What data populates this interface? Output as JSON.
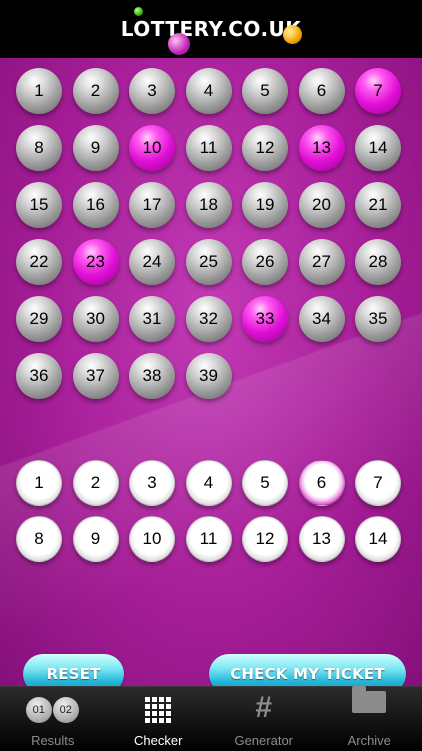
{
  "header": {
    "logo_text": "LOTTERY.CO.UK"
  },
  "main_balls": [
    {
      "n": "1",
      "sel": false
    },
    {
      "n": "2",
      "sel": false
    },
    {
      "n": "3",
      "sel": false
    },
    {
      "n": "4",
      "sel": false
    },
    {
      "n": "5",
      "sel": false
    },
    {
      "n": "6",
      "sel": false
    },
    {
      "n": "7",
      "sel": true
    },
    {
      "n": "8",
      "sel": false
    },
    {
      "n": "9",
      "sel": false
    },
    {
      "n": "10",
      "sel": true
    },
    {
      "n": "11",
      "sel": false
    },
    {
      "n": "12",
      "sel": false
    },
    {
      "n": "13",
      "sel": true
    },
    {
      "n": "14",
      "sel": false
    },
    {
      "n": "15",
      "sel": false
    },
    {
      "n": "16",
      "sel": false
    },
    {
      "n": "17",
      "sel": false
    },
    {
      "n": "18",
      "sel": false
    },
    {
      "n": "19",
      "sel": false
    },
    {
      "n": "20",
      "sel": false
    },
    {
      "n": "21",
      "sel": false
    },
    {
      "n": "22",
      "sel": false
    },
    {
      "n": "23",
      "sel": true
    },
    {
      "n": "24",
      "sel": false
    },
    {
      "n": "25",
      "sel": false
    },
    {
      "n": "26",
      "sel": false
    },
    {
      "n": "27",
      "sel": false
    },
    {
      "n": "28",
      "sel": false
    },
    {
      "n": "29",
      "sel": false
    },
    {
      "n": "30",
      "sel": false
    },
    {
      "n": "31",
      "sel": false
    },
    {
      "n": "32",
      "sel": false
    },
    {
      "n": "33",
      "sel": true
    },
    {
      "n": "34",
      "sel": false
    },
    {
      "n": "35",
      "sel": false
    },
    {
      "n": "36",
      "sel": false
    },
    {
      "n": "37",
      "sel": false
    },
    {
      "n": "38",
      "sel": false
    },
    {
      "n": "39",
      "sel": false
    }
  ],
  "bonus_balls": [
    {
      "n": "1",
      "sel": false
    },
    {
      "n": "2",
      "sel": false
    },
    {
      "n": "3",
      "sel": false
    },
    {
      "n": "4",
      "sel": false
    },
    {
      "n": "5",
      "sel": false
    },
    {
      "n": "6",
      "sel": true
    },
    {
      "n": "7",
      "sel": false
    },
    {
      "n": "8",
      "sel": false
    },
    {
      "n": "9",
      "sel": false
    },
    {
      "n": "10",
      "sel": false
    },
    {
      "n": "11",
      "sel": false
    },
    {
      "n": "12",
      "sel": false
    },
    {
      "n": "13",
      "sel": false
    },
    {
      "n": "14",
      "sel": false
    }
  ],
  "buttons": {
    "reset": "RESET",
    "check": "CHECK MY TICKET"
  },
  "tabs": {
    "results": {
      "label": "Results",
      "icon": "results-balls-icon",
      "ball1": "01",
      "ball2": "02"
    },
    "checker": {
      "label": "Checker",
      "icon": "grid-icon"
    },
    "generator": {
      "label": "Generator",
      "icon": "hash-icon",
      "glyph": "#"
    },
    "archive": {
      "label": "Archive",
      "icon": "folder-icon"
    }
  },
  "colors": {
    "background": "#a61e98",
    "selected_ball": "#e010d6",
    "button": "#22b4d6"
  }
}
